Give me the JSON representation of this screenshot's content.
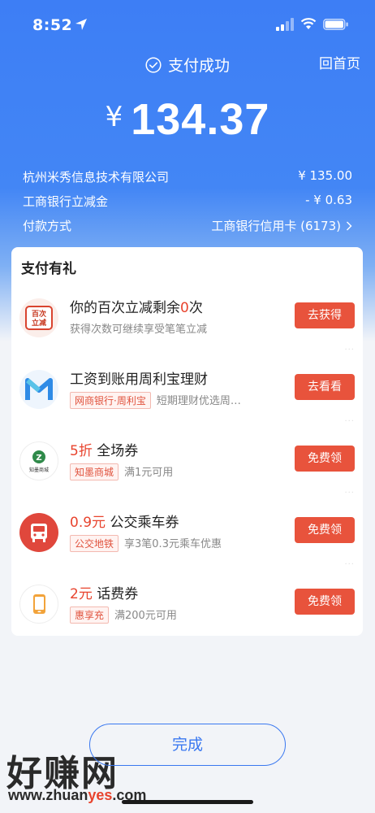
{
  "status_bar": {
    "time": "8:52"
  },
  "header": {
    "title": "支付成功",
    "home_link": "回首页",
    "currency": "¥",
    "amount": "134.37"
  },
  "details": [
    {
      "label": "杭州米秀信息技术有限公司",
      "value": "¥ 135.00"
    },
    {
      "label": "工商银行立减金",
      "value": "- ¥ 0.63"
    },
    {
      "label": "付款方式",
      "value": "工商银行信用卡 (6173)"
    }
  ],
  "gifts": {
    "title": "支付有礼",
    "items": [
      {
        "title_prefix": "你的百次立减剩余",
        "title_highlight": "0",
        "title_suffix": "次",
        "tag": "",
        "subtitle": "获得次数可继续享受笔笔立减",
        "button": "去获得",
        "icon_text": "百次\n立减"
      },
      {
        "title_prefix": "",
        "title_highlight": "",
        "title_suffix": "工资到账用周利宝理财",
        "tag": "网商银行·周利宝",
        "subtitle": "短期理财优选周…",
        "button": "去看看",
        "icon_text": ""
      },
      {
        "title_prefix": "",
        "title_highlight": "5折",
        "title_suffix": " 全场券",
        "tag": "知墨商城",
        "subtitle": "满1元可用",
        "button": "免费领",
        "icon_text": "知墨商城"
      },
      {
        "title_prefix": "",
        "title_highlight": "0.9元",
        "title_suffix": " 公交乘车券",
        "tag": "公交地铁",
        "subtitle": "享3笔0.3元乘车优惠",
        "button": "免费领",
        "icon_text": ""
      },
      {
        "title_prefix": "",
        "title_highlight": "2元",
        "title_suffix": " 话费券",
        "tag": "惠享充",
        "subtitle": "满200元可用",
        "button": "免费领",
        "icon_text": ""
      }
    ]
  },
  "done_button": "完成",
  "watermark": {
    "main": "好赚网",
    "url_prefix": "www.zhuan",
    "url_highlight": "yes",
    "url_suffix": ".com"
  },
  "colors": {
    "primary": "#3d7ef5",
    "accent_red": "#e8442e",
    "button_red": "#e8533c"
  }
}
